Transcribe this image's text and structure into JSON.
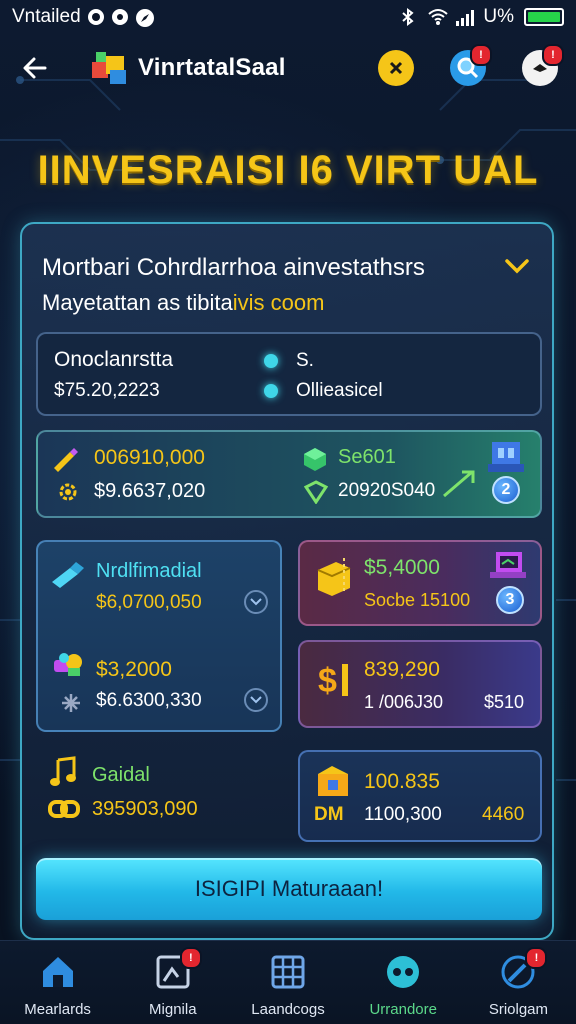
{
  "status_bar": {
    "left_text": "Vntailed",
    "right_text": "U%"
  },
  "app_bar": {
    "title": "VinrtatalSaal"
  },
  "headline": "IINVESRAISI I6 VIRT UAL",
  "panel": {
    "title": "Mortbari  Cohrdlarrhoa ainvestathsrs",
    "subtitle_prefix": "Mayetattan as tibita",
    "subtitle_highlight": "ivis coom"
  },
  "info_card": {
    "label": "Onoclanrstta",
    "value": "$75.20,2223",
    "right_label_1": "S.",
    "right_label_2": "Ollieasicel"
  },
  "wide_card": {
    "left_value_1": "006910,000",
    "left_value_2": "$9.6637,020",
    "right_label_1": "Se601",
    "right_value_2": "20920S040",
    "badge": "2"
  },
  "card_left_big": {
    "title": "Nrdlfimadial",
    "value_1": "$6,0700,050",
    "value_2": "$3,2000",
    "value_3": "$6.6300,330"
  },
  "card_right_1": {
    "value_1": "$5,4000",
    "value_2": "Socbe 15100",
    "badge": "3"
  },
  "card_right_2": {
    "value_1": "839,290",
    "value_2": "1 /006J30",
    "value_3": "$510"
  },
  "gold_section": {
    "label": "Gaidal",
    "value": "395903,090"
  },
  "card_right_3": {
    "value_1": "100.835",
    "prefix": "DM",
    "value_2": "1100,300",
    "value_3": "4460"
  },
  "cta": {
    "label": "ISIGIPI Maturaaan!"
  },
  "bottom_nav": {
    "items": [
      {
        "label": "Mearlards"
      },
      {
        "label": "Mignila"
      },
      {
        "label": "Laandcogs"
      },
      {
        "label": "Urrandore"
      },
      {
        "label": "Sriolgam"
      }
    ],
    "badges": {
      "item_2": "!",
      "item_5": "!"
    }
  },
  "colors": {
    "accent_yellow": "#f5c518",
    "accent_cyan": "#4fe0f2",
    "accent_green": "#7ee36b",
    "panel_border": "#3ea8c4",
    "active_nav": "#5bd88a"
  }
}
